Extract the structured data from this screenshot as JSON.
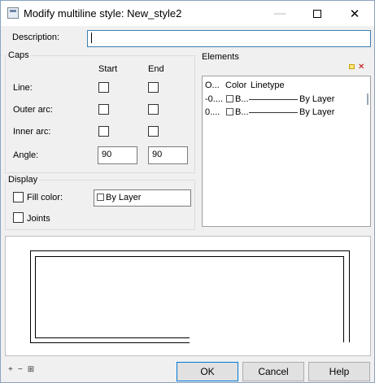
{
  "window": {
    "title": "Modify multiline style: New_style2",
    "minimize_glyph": "—",
    "close_glyph": "✕"
  },
  "description": {
    "label": "Description:",
    "value": ""
  },
  "caps": {
    "title": "Caps",
    "start_header": "Start",
    "end_header": "End",
    "line_label": "Line:",
    "outer_arc_label": "Outer arc:",
    "inner_arc_label": "Inner arc:",
    "angle_label": "Angle:",
    "angle_start": "90",
    "angle_end": "90"
  },
  "display": {
    "title": "Display",
    "fill_color_label": "Fill color:",
    "fill_color_value": "By Layer",
    "joints_label": "Joints"
  },
  "elements": {
    "title": "Elements",
    "columns": [
      "O...",
      "Color",
      "Linetype"
    ],
    "rows": [
      {
        "offset": "-0....",
        "color": "B...",
        "linetype": "By Layer"
      },
      {
        "offset": "0....",
        "color": "B...",
        "linetype": "By Layer"
      }
    ],
    "add_icon": "folder-add-icon",
    "delete_glyph": "✕"
  },
  "zoom": {
    "zoom_in": "+",
    "zoom_out": "−",
    "fit": "⊞"
  },
  "buttons": {
    "ok": "OK",
    "cancel": "Cancel",
    "help": "Help"
  }
}
